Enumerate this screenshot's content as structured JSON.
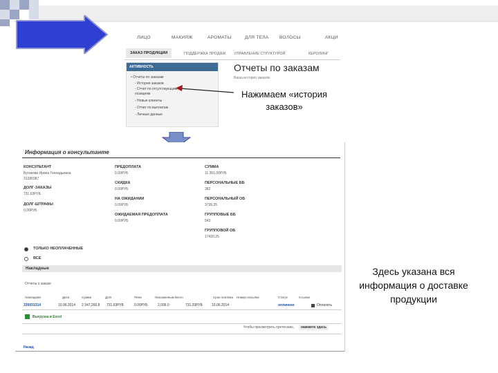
{
  "top_nav": [
    "ЛИЦО",
    "МАКИЯЖ",
    "АРОМАТЫ",
    "ДЛЯ ТЕЛА",
    "ВОЛОСЫ",
    "АКЦИ"
  ],
  "tabs": [
    "ЗАКАЗ ПРОДУКЦИИ",
    "ПОДДЕРЖКА ПРОДАЖ",
    "УПРАВЛЕНИЕ СТРУКТУРОЙ",
    "КЕРОЛИНГ"
  ],
  "sidebar": {
    "header": "АКТИВНОСТЬ",
    "items": [
      "• Отчеты по заказам",
      "- История заказов",
      "- Отчет по отсутствующим",
      "  позициям",
      "- Новые клиенты",
      "- Отчет по выплатам",
      "- Личные данные"
    ]
  },
  "page_title": "Отчеты по заказам",
  "page_subtitle": "Ваша история заказов",
  "callout_top": "Нажимаем «история заказов»",
  "info": {
    "title": "Информация о консультанте",
    "col1": [
      {
        "label": "КОНСУЛЬТАНТ",
        "values": [
          "Бутакова Ирина Геннадьевна",
          "31280387"
        ]
      },
      {
        "label": "ДОЛГ-ЗАКАЗЫ",
        "values": [
          "731,63РУБ"
        ]
      },
      {
        "label": "ДОЛГ-ШТРАФЫ",
        "values": [
          "0.00РУБ"
        ]
      }
    ],
    "col2": [
      {
        "label": "ПРЕДОПЛАТА",
        "values": [
          "0.00РУБ"
        ]
      },
      {
        "label": "СКИДКА",
        "values": [
          "0.00РУБ"
        ]
      },
      {
        "label": "НА ОЖИДАНИИ",
        "values": [
          "0.00РУБ"
        ]
      },
      {
        "label": "ОЖИДАЕМАЯ ПРЕДОПЛАТА",
        "values": [
          "0.00РУБ"
        ]
      }
    ],
    "col3": [
      {
        "label": "СУММА",
        "values": [
          "11 351,00РУБ"
        ]
      },
      {
        "label": "ПЕРСОНАЛЬНЫЕ ББ",
        "values": [
          "382"
        ]
      },
      {
        "label": "ПЕРСОНАЛЬНЫЙ ОБ",
        "values": [
          "3735.25"
        ]
      },
      {
        "label": "ГРУППОВЫЕ ББ",
        "values": [
          "543"
        ]
      },
      {
        "label": "ГРУППОВОЙ ОБ",
        "values": [
          "17420.25"
        ]
      }
    ]
  },
  "filters": {
    "unpaid": "ТОЛЬКО НЕОПЛАЧЕННЫЕ",
    "all": "ВСЕ"
  },
  "invoices": {
    "header": "Накладные",
    "subheader": "Отчеты о заказе",
    "columns": [
      "Накладная",
      "Дата",
      "Сумма",
      "Долг",
      "Пени",
      "Наложенным Всего",
      "Срок платежа",
      "Номер посылки",
      "Статус",
      "Ссылки"
    ],
    "row": [
      "330031314",
      "10.06.2014",
      "2 347,266.8",
      "731.63РУБ",
      "0.00РУБ",
      "2,006.0",
      "731.33РУБ",
      "10.06.2014",
      "оплачено",
      "Оплатить"
    ],
    "export": "Выгрузка в Excel",
    "note": "Чтобы просмотреть претензию,",
    "note_link": "нажмите здесь",
    "back": "Назад"
  },
  "callout_bottom": "Здесь указана вся информация о доставке продукции"
}
